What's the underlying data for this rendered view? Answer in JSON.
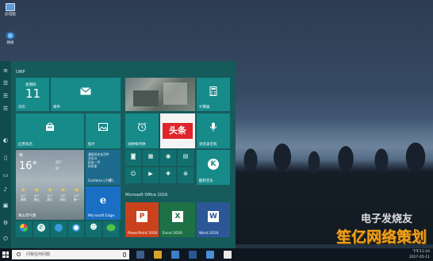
{
  "desktop": {
    "icons": [
      {
        "label": "此电脑",
        "icon": "computer-icon"
      },
      {
        "label": "网络",
        "icon": "network-icon"
      }
    ]
  },
  "start_menu": {
    "group_uwp": "UWP",
    "group_office": "Microsoft Office 2016",
    "rail_icons": [
      "hamburger-menu-icon",
      "list-icon",
      "list-icon",
      "list-icon",
      "user-icon",
      "document-icon",
      "picture-icon",
      "music-icon",
      "picture-icon",
      "settings-icon",
      "power-icon"
    ],
    "tiles": {
      "calendar": {
        "weekday": "星期四",
        "day": "11",
        "label": "日历"
      },
      "mail": {
        "label": "邮件"
      },
      "store": {
        "label": "应用商店"
      },
      "photos": {
        "label": "照片"
      },
      "cortana": {
        "lines": [
          "漫说历史长河中",
          "文化与",
          "纪念一代",
          "科学家"
        ],
        "label": "Cortana (小娜)"
      },
      "calculator": {
        "label": "计算器"
      },
      "alarms": {
        "label": "闹钟和时钟"
      },
      "toutiao": {
        "text": "头条"
      },
      "recorder": {
        "label": "语音录音机"
      },
      "weather": {
        "condition": "晴",
        "temp": "16°",
        "hi": "22°",
        "lo": "9°",
        "label": "青山市气象",
        "days": [
          {
            "d": "周四",
            "t": "22°"
          },
          {
            "d": "周五",
            "t": "22°"
          },
          {
            "d": "周六",
            "t": "21°"
          },
          {
            "d": "周日",
            "t": "23°"
          },
          {
            "d": "周一",
            "t": "23°"
          }
        ]
      },
      "edge": {
        "label": "Microsoft Edge"
      },
      "kugou": {
        "label": "酷狗音乐"
      },
      "powerpoint": {
        "label": "PowerPoint 2016"
      },
      "excel": {
        "label": "Excel 2016"
      },
      "word": {
        "label": "Word 2016"
      }
    }
  },
  "taskbar": {
    "search_placeholder": "问我任何问题",
    "time": "下午11:10",
    "date": "2017-05-11"
  },
  "watermark": {
    "top": "电子发烧友",
    "bottom": "笙亿网络策划"
  },
  "colors": {
    "tile": "#178a8a",
    "start_bg": "#165c5c",
    "toutiao": "#e0242b",
    "edge": "#1a6fc4",
    "powerpoint": "#c9421d",
    "excel": "#1d7145",
    "word": "#2b5797",
    "watermark": "#f2a21b"
  }
}
